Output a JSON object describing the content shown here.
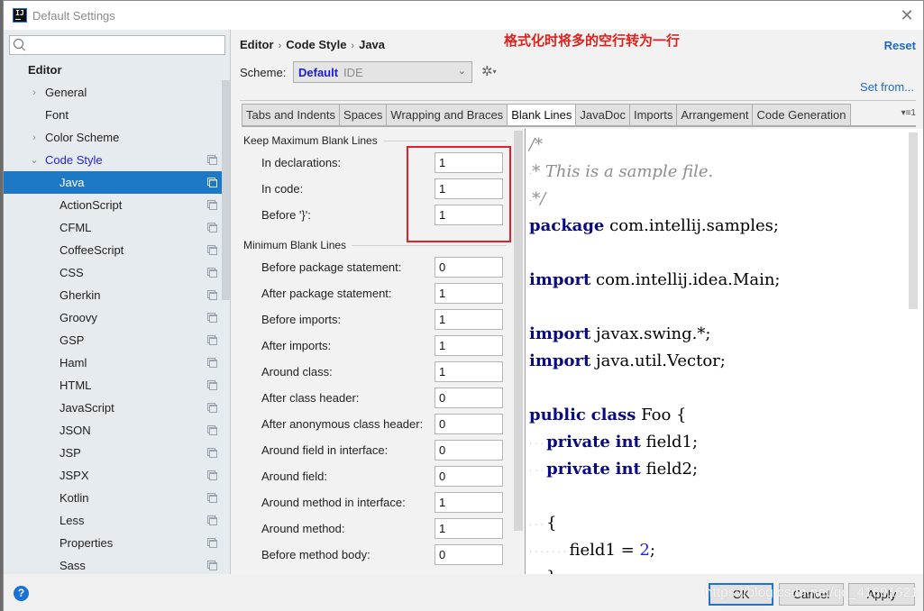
{
  "window": {
    "title": "Default Settings",
    "app_icon_text": "IJ",
    "close_glyph": "✕"
  },
  "sidebar": {
    "search_placeholder": "",
    "search_value": "",
    "section": "Editor",
    "items": [
      {
        "label": "General",
        "level": 1,
        "arrow": "›"
      },
      {
        "label": "Font",
        "level": 1,
        "arrow": ""
      },
      {
        "label": "Color Scheme",
        "level": 1,
        "arrow": "›"
      },
      {
        "label": "Code Style",
        "level": 1,
        "arrow": "⌄",
        "expanded": true,
        "copy": true
      },
      {
        "label": "Java",
        "level": 2,
        "selected": true,
        "copy": true
      },
      {
        "label": "ActionScript",
        "level": 2,
        "copy": true
      },
      {
        "label": "CFML",
        "level": 2,
        "copy": true
      },
      {
        "label": "CoffeeScript",
        "level": 2,
        "copy": true
      },
      {
        "label": "CSS",
        "level": 2,
        "copy": true
      },
      {
        "label": "Gherkin",
        "level": 2,
        "copy": true
      },
      {
        "label": "Groovy",
        "level": 2,
        "copy": true
      },
      {
        "label": "GSP",
        "level": 2,
        "copy": true
      },
      {
        "label": "Haml",
        "level": 2,
        "copy": true
      },
      {
        "label": "HTML",
        "level": 2,
        "copy": true
      },
      {
        "label": "JavaScript",
        "level": 2,
        "copy": true
      },
      {
        "label": "JSON",
        "level": 2,
        "copy": true
      },
      {
        "label": "JSP",
        "level": 2,
        "copy": true
      },
      {
        "label": "JSPX",
        "level": 2,
        "copy": true
      },
      {
        "label": "Kotlin",
        "level": 2,
        "copy": true
      },
      {
        "label": "Less",
        "level": 2,
        "copy": true
      },
      {
        "label": "Properties",
        "level": 2,
        "copy": true
      },
      {
        "label": "Sass",
        "level": 2,
        "copy": true
      }
    ]
  },
  "header": {
    "breadcrumb": [
      "Editor",
      "Code Style",
      "Java"
    ],
    "breadcrumb_sep": "›",
    "annotation": "格式化时将多的空行转为一行",
    "reset_label": "Reset",
    "scheme_label": "Scheme:",
    "scheme_name": "Default",
    "scheme_kind": "IDE",
    "scheme_chevron": "⌄",
    "gear_glyph": "✲",
    "gear_arrow": "▾",
    "set_from_label": "Set from..."
  },
  "tabs": {
    "items": [
      "Tabs and Indents",
      "Spaces",
      "Wrapping and Braces",
      "Blank Lines",
      "JavaDoc",
      "Imports",
      "Arrangement",
      "Code Generation"
    ],
    "active": "Blank Lines",
    "overflow_glyph": "▾≡1"
  },
  "blank_lines": {
    "keep_maximum": {
      "title": "Keep Maximum Blank Lines",
      "fields": [
        {
          "label": "In declarations:",
          "value": "1"
        },
        {
          "label": "In code:",
          "value": "1"
        },
        {
          "label": "Before '}':",
          "value": "1"
        }
      ]
    },
    "minimum": {
      "title": "Minimum Blank Lines",
      "fields": [
        {
          "label": "Before package statement:",
          "value": "0"
        },
        {
          "label": "After package statement:",
          "value": "1"
        },
        {
          "label": "Before imports:",
          "value": "1"
        },
        {
          "label": "After imports:",
          "value": "1"
        },
        {
          "label": "Around class:",
          "value": "1"
        },
        {
          "label": "After class header:",
          "value": "0"
        },
        {
          "label": "After anonymous class header:",
          "value": "0"
        },
        {
          "label": "Around field in interface:",
          "value": "0"
        },
        {
          "label": "Around field:",
          "value": "0"
        },
        {
          "label": "Around method in interface:",
          "value": "1"
        },
        {
          "label": "Around method:",
          "value": "1"
        },
        {
          "label": "Before method body:",
          "value": "0"
        }
      ]
    }
  },
  "preview": {
    "lines": [
      [
        {
          "t": "/*",
          "c": "cm"
        }
      ],
      [
        {
          "t": "·",
          "c": "ws"
        },
        {
          "t": "* This is a sample file.",
          "c": "cm"
        }
      ],
      [
        {
          "t": "·",
          "c": "ws"
        },
        {
          "t": "*/",
          "c": "cm"
        }
      ],
      [
        {
          "t": "package",
          "c": "kw"
        },
        {
          "t": " com.intellij.samples;",
          "c": ""
        }
      ],
      [],
      [
        {
          "t": "import",
          "c": "kw"
        },
        {
          "t": " com.intellij.idea.Main;",
          "c": ""
        }
      ],
      [],
      [
        {
          "t": "import",
          "c": "kw"
        },
        {
          "t": " javax.swing.*;",
          "c": ""
        }
      ],
      [
        {
          "t": "import",
          "c": "kw"
        },
        {
          "t": " java.util.Vector;",
          "c": ""
        }
      ],
      [],
      [
        {
          "t": "public",
          "c": "kw"
        },
        {
          "t": " ",
          "c": ""
        },
        {
          "t": "class",
          "c": "kw"
        },
        {
          "t": " Foo {",
          "c": ""
        }
      ],
      [
        {
          "t": "· · · ",
          "c": "ws"
        },
        {
          "t": "private",
          "c": "kw"
        },
        {
          "t": " ",
          "c": ""
        },
        {
          "t": "int",
          "c": "kw"
        },
        {
          "t": " field1;",
          "c": ""
        }
      ],
      [
        {
          "t": "· · · ",
          "c": "ws"
        },
        {
          "t": "private",
          "c": "kw"
        },
        {
          "t": " ",
          "c": ""
        },
        {
          "t": "int",
          "c": "kw"
        },
        {
          "t": " field2;",
          "c": ""
        }
      ],
      [],
      [
        {
          "t": "· · · ",
          "c": "ws"
        },
        {
          "t": "{",
          "c": ""
        }
      ],
      [
        {
          "t": "· · · · · · · ",
          "c": "ws"
        },
        {
          "t": "field1 = ",
          "c": ""
        },
        {
          "t": "2",
          "c": "num"
        },
        {
          "t": ";",
          "c": ""
        }
      ],
      [
        {
          "t": "· · · ",
          "c": "ws"
        },
        {
          "t": "}",
          "c": ""
        }
      ]
    ]
  },
  "footer": {
    "help_glyph": "?",
    "ok_label": "OK",
    "cancel_label": "Cancel",
    "apply_label": "Apply",
    "watermark": "https://blog.csdn.net/qq_41691621"
  }
}
